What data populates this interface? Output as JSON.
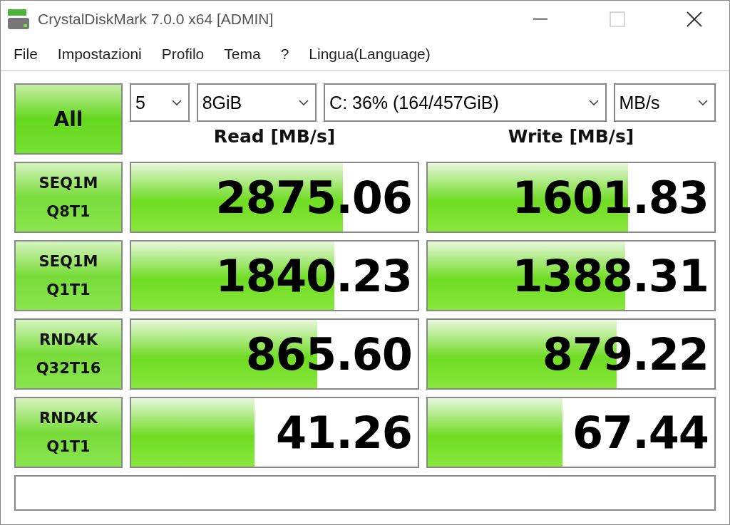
{
  "window": {
    "title": "CrystalDiskMark 7.0.0 x64 [ADMIN]"
  },
  "menu": [
    "File",
    "Impostazioni",
    "Profilo",
    "Tema",
    "?",
    "Lingua(Language)"
  ],
  "all_button": {
    "label": "All"
  },
  "selectors": [
    {
      "value": "5"
    },
    {
      "value": "8GiB"
    },
    {
      "value": "C: 36% (164/457GiB)"
    },
    {
      "value": "MB/s"
    }
  ],
  "headers": {
    "read": "Read [MB/s]",
    "write": "Write [MB/s]"
  },
  "rows": [
    {
      "test": [
        "SEQ1M",
        "Q8T1"
      ],
      "read": {
        "value": "2875.06",
        "level": 0.74
      },
      "write": {
        "value": "1601.83",
        "level": 0.7
      }
    },
    {
      "test": [
        "SEQ1M",
        "Q1T1"
      ],
      "read": {
        "value": "1840.23",
        "level": 0.71
      },
      "write": {
        "value": "1388.31",
        "level": 0.69
      }
    },
    {
      "test": [
        "RND4K",
        "Q32T16"
      ],
      "read": {
        "value": "865.60",
        "level": 0.65
      },
      "write": {
        "value": "879.22",
        "level": 0.66
      }
    },
    {
      "test": [
        "RND4K",
        "Q1T1"
      ],
      "read": {
        "value": "41.26",
        "level": 0.43
      },
      "write": {
        "value": "67.44",
        "level": 0.47
      }
    }
  ]
}
